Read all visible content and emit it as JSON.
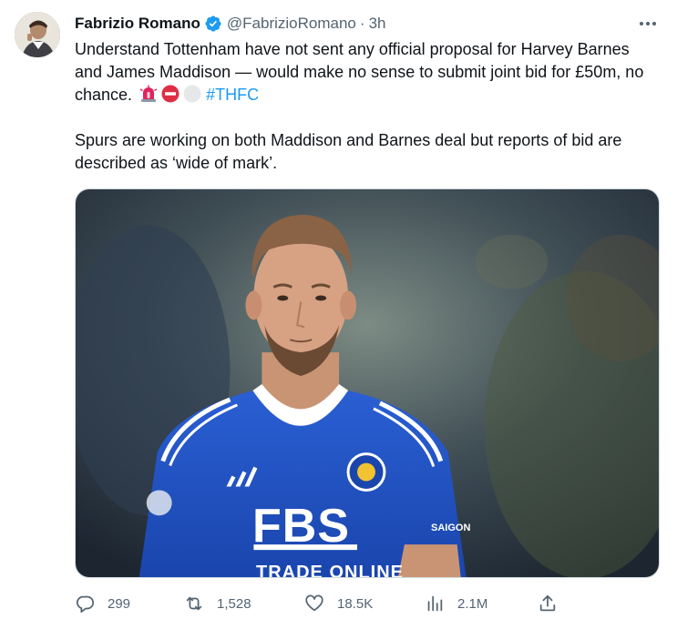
{
  "author": {
    "name": "Fabrizio Romano",
    "handle": "@FabrizioRomano",
    "separator": "·",
    "time": "3h",
    "verified": true,
    "verified_color": "#1d9bf0"
  },
  "tweet": {
    "paragraph1": "Understand Tottenham have not sent any official proposal for Harvey Barnes and James Maddison — would make no sense to submit joint bid for £50m, no chance.",
    "hashtag": "#THFC",
    "emojis": [
      "rotating-light",
      "no-entry",
      "white-circle"
    ],
    "paragraph2": "Spurs are working on both Maddison and Barnes deal but reports of bid are described as ‘wide of mark’."
  },
  "media": {
    "shirt_sponsor": "FBS",
    "shirt_sponsor_sub": "TRADE ONLINE",
    "sleeve_sponsor": "SAIGON",
    "kit_color": "#1f4fbf"
  },
  "actions": {
    "replies": "299",
    "retweets": "1,528",
    "likes": "18.5K",
    "views": "2.1M"
  },
  "colors": {
    "accent": "#1d9bf0",
    "secondary_text": "#536471",
    "primary_text": "#0f1419"
  }
}
